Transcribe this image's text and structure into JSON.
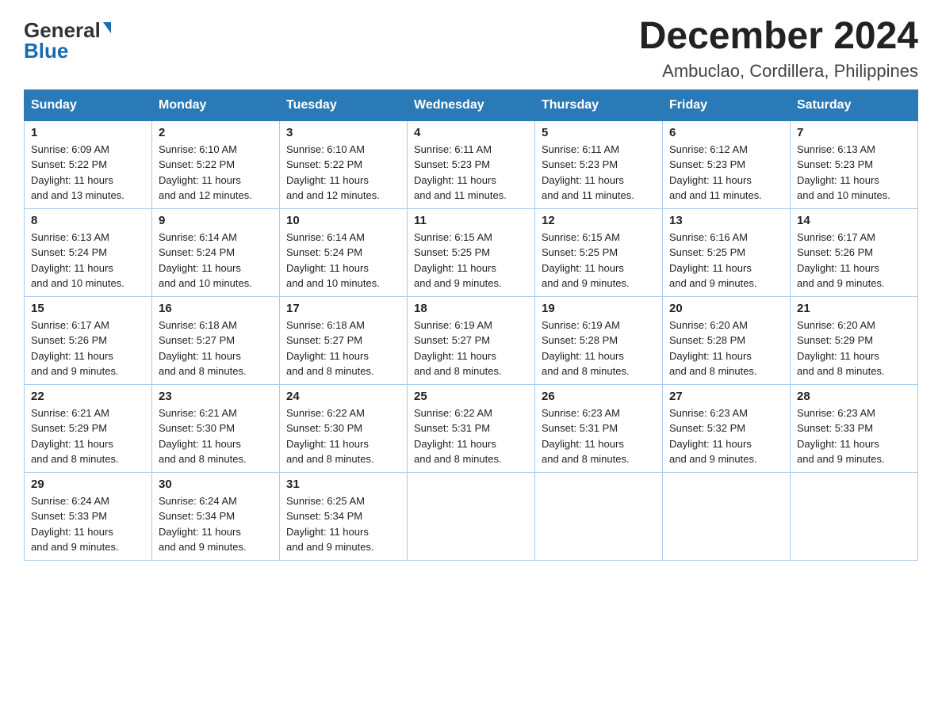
{
  "header": {
    "logo_general": "General",
    "logo_blue": "Blue",
    "month_title": "December 2024",
    "location": "Ambuclao, Cordillera, Philippines"
  },
  "weekdays": [
    "Sunday",
    "Monday",
    "Tuesday",
    "Wednesday",
    "Thursday",
    "Friday",
    "Saturday"
  ],
  "weeks": [
    [
      {
        "day": "1",
        "sunrise": "6:09 AM",
        "sunset": "5:22 PM",
        "daylight": "11 hours and 13 minutes."
      },
      {
        "day": "2",
        "sunrise": "6:10 AM",
        "sunset": "5:22 PM",
        "daylight": "11 hours and 12 minutes."
      },
      {
        "day": "3",
        "sunrise": "6:10 AM",
        "sunset": "5:22 PM",
        "daylight": "11 hours and 12 minutes."
      },
      {
        "day": "4",
        "sunrise": "6:11 AM",
        "sunset": "5:23 PM",
        "daylight": "11 hours and 11 minutes."
      },
      {
        "day": "5",
        "sunrise": "6:11 AM",
        "sunset": "5:23 PM",
        "daylight": "11 hours and 11 minutes."
      },
      {
        "day": "6",
        "sunrise": "6:12 AM",
        "sunset": "5:23 PM",
        "daylight": "11 hours and 11 minutes."
      },
      {
        "day": "7",
        "sunrise": "6:13 AM",
        "sunset": "5:23 PM",
        "daylight": "11 hours and 10 minutes."
      }
    ],
    [
      {
        "day": "8",
        "sunrise": "6:13 AM",
        "sunset": "5:24 PM",
        "daylight": "11 hours and 10 minutes."
      },
      {
        "day": "9",
        "sunrise": "6:14 AM",
        "sunset": "5:24 PM",
        "daylight": "11 hours and 10 minutes."
      },
      {
        "day": "10",
        "sunrise": "6:14 AM",
        "sunset": "5:24 PM",
        "daylight": "11 hours and 10 minutes."
      },
      {
        "day": "11",
        "sunrise": "6:15 AM",
        "sunset": "5:25 PM",
        "daylight": "11 hours and 9 minutes."
      },
      {
        "day": "12",
        "sunrise": "6:15 AM",
        "sunset": "5:25 PM",
        "daylight": "11 hours and 9 minutes."
      },
      {
        "day": "13",
        "sunrise": "6:16 AM",
        "sunset": "5:25 PM",
        "daylight": "11 hours and 9 minutes."
      },
      {
        "day": "14",
        "sunrise": "6:17 AM",
        "sunset": "5:26 PM",
        "daylight": "11 hours and 9 minutes."
      }
    ],
    [
      {
        "day": "15",
        "sunrise": "6:17 AM",
        "sunset": "5:26 PM",
        "daylight": "11 hours and 9 minutes."
      },
      {
        "day": "16",
        "sunrise": "6:18 AM",
        "sunset": "5:27 PM",
        "daylight": "11 hours and 8 minutes."
      },
      {
        "day": "17",
        "sunrise": "6:18 AM",
        "sunset": "5:27 PM",
        "daylight": "11 hours and 8 minutes."
      },
      {
        "day": "18",
        "sunrise": "6:19 AM",
        "sunset": "5:27 PM",
        "daylight": "11 hours and 8 minutes."
      },
      {
        "day": "19",
        "sunrise": "6:19 AM",
        "sunset": "5:28 PM",
        "daylight": "11 hours and 8 minutes."
      },
      {
        "day": "20",
        "sunrise": "6:20 AM",
        "sunset": "5:28 PM",
        "daylight": "11 hours and 8 minutes."
      },
      {
        "day": "21",
        "sunrise": "6:20 AM",
        "sunset": "5:29 PM",
        "daylight": "11 hours and 8 minutes."
      }
    ],
    [
      {
        "day": "22",
        "sunrise": "6:21 AM",
        "sunset": "5:29 PM",
        "daylight": "11 hours and 8 minutes."
      },
      {
        "day": "23",
        "sunrise": "6:21 AM",
        "sunset": "5:30 PM",
        "daylight": "11 hours and 8 minutes."
      },
      {
        "day": "24",
        "sunrise": "6:22 AM",
        "sunset": "5:30 PM",
        "daylight": "11 hours and 8 minutes."
      },
      {
        "day": "25",
        "sunrise": "6:22 AM",
        "sunset": "5:31 PM",
        "daylight": "11 hours and 8 minutes."
      },
      {
        "day": "26",
        "sunrise": "6:23 AM",
        "sunset": "5:31 PM",
        "daylight": "11 hours and 8 minutes."
      },
      {
        "day": "27",
        "sunrise": "6:23 AM",
        "sunset": "5:32 PM",
        "daylight": "11 hours and 9 minutes."
      },
      {
        "day": "28",
        "sunrise": "6:23 AM",
        "sunset": "5:33 PM",
        "daylight": "11 hours and 9 minutes."
      }
    ],
    [
      {
        "day": "29",
        "sunrise": "6:24 AM",
        "sunset": "5:33 PM",
        "daylight": "11 hours and 9 minutes."
      },
      {
        "day": "30",
        "sunrise": "6:24 AM",
        "sunset": "5:34 PM",
        "daylight": "11 hours and 9 minutes."
      },
      {
        "day": "31",
        "sunrise": "6:25 AM",
        "sunset": "5:34 PM",
        "daylight": "11 hours and 9 minutes."
      },
      null,
      null,
      null,
      null
    ]
  ],
  "labels": {
    "sunrise": "Sunrise:",
    "sunset": "Sunset:",
    "daylight": "Daylight:"
  }
}
